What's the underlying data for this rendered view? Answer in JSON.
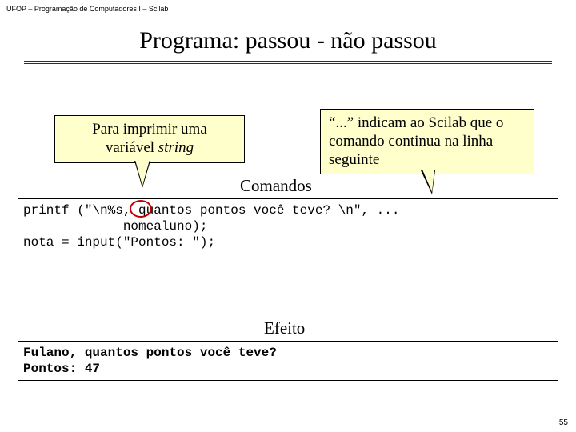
{
  "header": "UFOP – Programação de Computadores I – Scilab",
  "title": "Programa: passou - não passou",
  "callouts": {
    "left_line1": "Para imprimir uma",
    "left_line2_pre": "variável ",
    "left_line2_em": "string",
    "right": "“...” indicam ao Scilab que o comando continua na linha seguinte"
  },
  "labels": {
    "comandos": "Comandos",
    "efeito": "Efeito"
  },
  "code": {
    "comandos": "printf (\"\\n%s, quantos pontos você teve? \\n\", ...\n             nomealuno);\nnota = input(\"Pontos: \");",
    "efeito": "Fulano, quantos pontos você teve?\nPontos: 47"
  },
  "slide_number": "55"
}
